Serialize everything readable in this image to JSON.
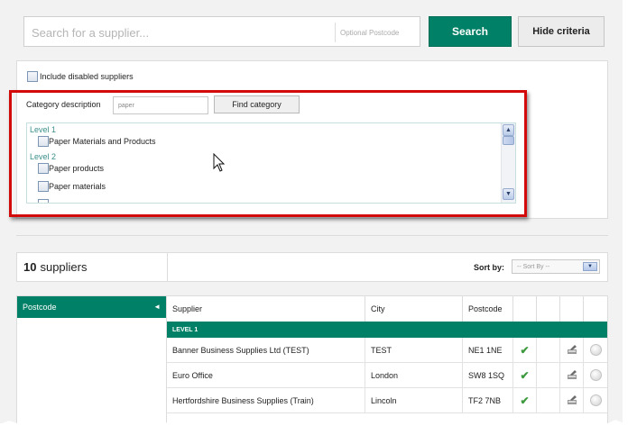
{
  "search": {
    "placeholder": "Search for a supplier...",
    "postcode_placeholder": "Optional Postcode",
    "search_label": "Search",
    "hide_label": "Hide criteria"
  },
  "criteria": {
    "include_disabled_label": "Include disabled suppliers",
    "include_disabled_checked": false,
    "category_description_label": "Category description",
    "category_value": "paper",
    "find_category_label": "Find category",
    "levels": [
      {
        "label": "Level 1",
        "items": [
          "Paper Materials and Products"
        ]
      },
      {
        "label": "Level 2",
        "items": [
          "Paper products",
          "Paper materials"
        ]
      }
    ]
  },
  "results": {
    "count": "10",
    "count_label": "suppliers",
    "sort_by_label": "Sort by:",
    "sort_by_value": "-- Sort By --",
    "facet_label": "Postcode",
    "columns": [
      "Supplier",
      "City",
      "Postcode"
    ],
    "group_label": "LEVEL 1",
    "rows": [
      {
        "supplier": "Banner Business Supplies Ltd (TEST)",
        "city": "TEST",
        "postcode": "NE1 1NE"
      },
      {
        "supplier": "Euro Office",
        "city": "London",
        "postcode": "SW8 1SQ"
      },
      {
        "supplier": "Hertfordshire Business Supplies (Train)",
        "city": "Lincoln",
        "postcode": "TF2 7NB"
      }
    ]
  },
  "colors": {
    "accent": "#008066",
    "highlight": "#d20a0a",
    "level_text": "#3b8f8b"
  }
}
